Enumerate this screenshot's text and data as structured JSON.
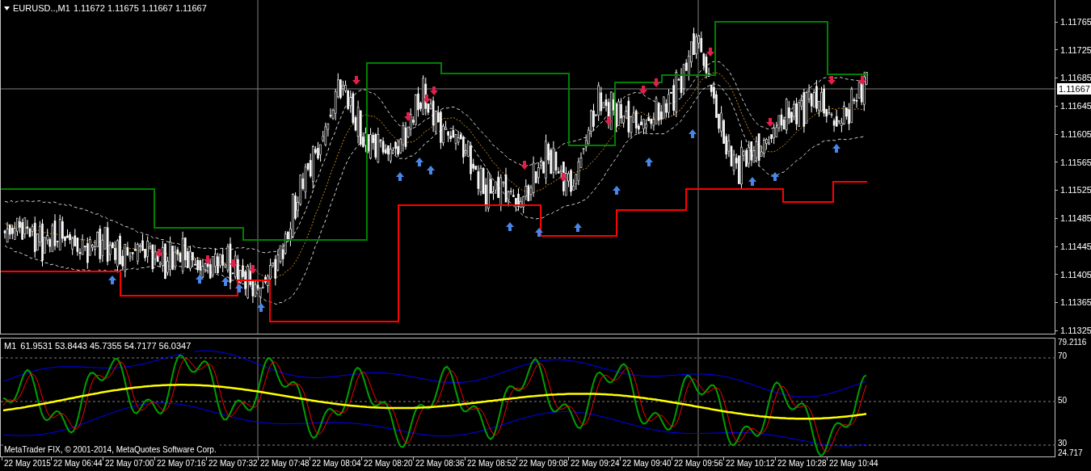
{
  "chart": {
    "symbol_label": "EURUSD..,M1",
    "ohlc": "1.11672 1.11675 1.11667 1.11667",
    "price_axis": [
      "1.11765",
      "1.11725",
      "1.11685",
      "1.11645",
      "1.11605",
      "1.11565",
      "1.11525",
      "1.11485",
      "1.11445",
      "1.11405",
      "1.11365",
      "1.11325"
    ],
    "current_price": "1.11667"
  },
  "indicator": {
    "label": "M1",
    "values": "61.9531 53.8443 45.7355 54.7177 56.0347",
    "axis": [
      "79.2116",
      "70",
      "50",
      "30",
      "24.717"
    ]
  },
  "copyright": "MetaTrader FIX, © 2001-2014, MetaQuotes Software Corp.",
  "time_axis": [
    "22 May 2015",
    "22 May 06:44",
    "22 May 07:00",
    "22 May 07:16",
    "22 May 07:32",
    "22 May 07:48",
    "22 May 08:04",
    "22 May 08:20",
    "22 May 08:36",
    "22 May 08:52",
    "22 May 09:08",
    "22 May 09:24",
    "22 May 09:40",
    "22 May 09:56",
    "22 May 10:12",
    "22 May 10:28",
    "22 May 10:44"
  ]
}
